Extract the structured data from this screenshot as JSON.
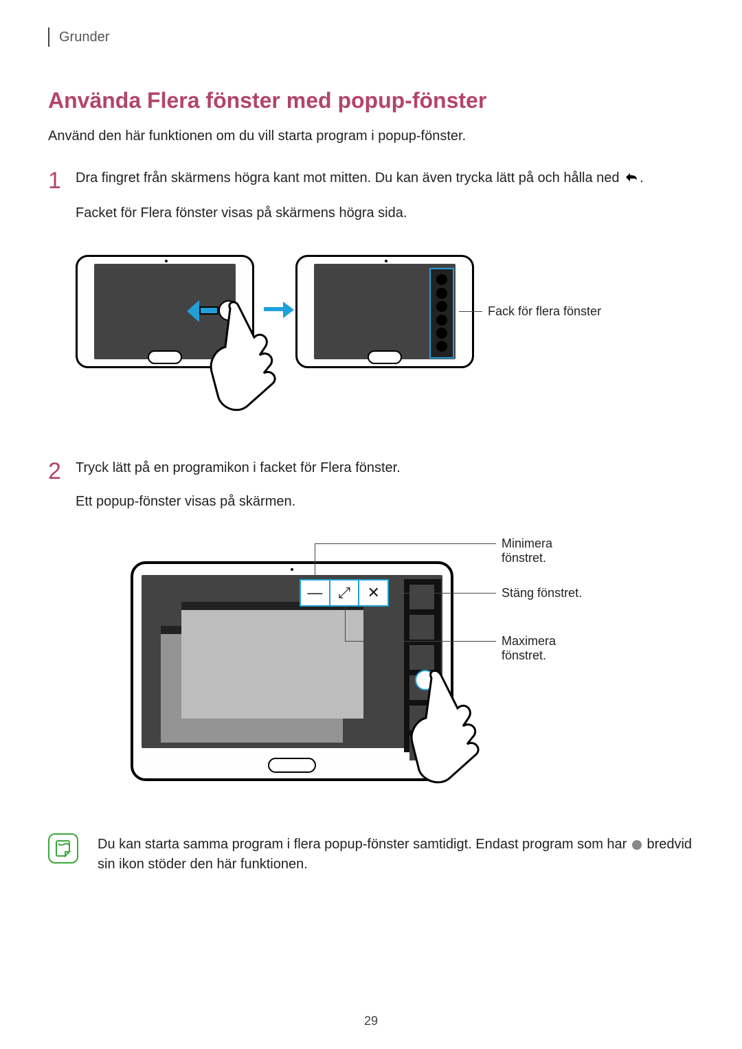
{
  "header": {
    "breadcrumb": "Grunder"
  },
  "section": {
    "title": "Använda Flera fönster med popup-fönster",
    "intro": "Använd den här funktionen om du vill starta program i popup-fönster."
  },
  "steps": [
    {
      "num": "1",
      "line1_pre": "Dra fingret från skärmens högra kant mot mitten. Du kan även trycka lätt på och hålla ned ",
      "line1_post": ".",
      "line2": "Facket för Flera fönster visas på skärmens högra sida."
    },
    {
      "num": "2",
      "line1": "Tryck lätt på en programikon i facket för Flera fönster.",
      "line2": "Ett popup-fönster visas på skärmen."
    }
  ],
  "fig1": {
    "tray_label": "Fack för flera fönster"
  },
  "fig2": {
    "minimize": "Minimera fönstret.",
    "close": "Stäng fönstret.",
    "maximize": "Maximera fönstret."
  },
  "note": {
    "text_pre": "Du kan starta samma program i flera popup-fönster samtidigt. Endast program som har ",
    "text_post": " bredvid sin ikon stöder den här funktionen."
  },
  "page_number": "29"
}
